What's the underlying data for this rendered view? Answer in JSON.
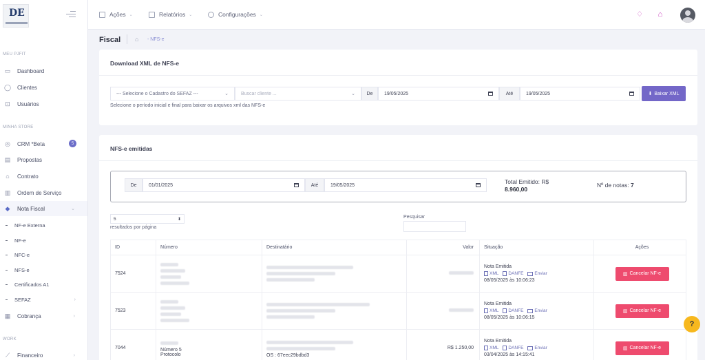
{
  "sidebar": {
    "sections": [
      {
        "title": "MEU PJFIT"
      },
      {
        "title": "MINHA STORE"
      },
      {
        "title": "WORK"
      }
    ],
    "items": [
      {
        "label": "Dashboard",
        "icon": "dashboard-icon"
      },
      {
        "label": "Clientes",
        "icon": "clients-icon"
      },
      {
        "label": "Usuários",
        "icon": "users-icon"
      },
      {
        "label": "CRM *Beta",
        "icon": "crm-icon",
        "badge": "5"
      },
      {
        "label": "Propostas",
        "icon": "proposals-icon"
      },
      {
        "label": "Contrato",
        "icon": "contract-icon"
      },
      {
        "label": "Ordem de Serviço",
        "icon": "service-order-icon"
      },
      {
        "label": "Nota Fiscal",
        "icon": "invoice-icon"
      },
      {
        "label": "Cobrança",
        "icon": "billing-icon"
      },
      {
        "label": "Financeiro",
        "icon": "finance-icon"
      }
    ],
    "subitems": [
      {
        "label": "NF-e Externa"
      },
      {
        "label": "NF-e"
      },
      {
        "label": "NFC-e"
      },
      {
        "label": "NFS-e"
      },
      {
        "label": "Certificados A1"
      },
      {
        "label": "SEFAZ"
      }
    ]
  },
  "topbar": {
    "menus": [
      {
        "label": "Ações"
      },
      {
        "label": "Relatórios"
      },
      {
        "label": "Configurações"
      }
    ]
  },
  "breadcrumb": {
    "title": "Fiscal",
    "current": "- NFS-e"
  },
  "download_card": {
    "title": "Download XML de NFS-e",
    "cadastro_placeholder": "--- Selecione o Cadastro do SEFAZ ---",
    "cliente_placeholder": "Buscar cliente ...",
    "de_label": "De",
    "de_value": "19/05/2025",
    "ate_label": "Até",
    "ate_value": "19/05/2025",
    "button_label": "Baixar XML",
    "hint": "Selecione o período inicial e final para baixar os arquivos xml das NFS-e"
  },
  "emitidas_card": {
    "title": "NFS-e emitidas",
    "de_label": "De",
    "de_value": "01/01/2025",
    "ate_label": "Até",
    "ate_value": "19/05/2025",
    "total_label": "Total Emitido: R$",
    "total_value": "8.960,00",
    "notas_label": "Nº de notas:",
    "notas_value": "7",
    "page_size": "5",
    "page_size_label": "resultados por página",
    "search_label": "Pesquisar",
    "columns": [
      "ID",
      "Número",
      "Destinatário",
      "Valor",
      "Situação",
      "Ações"
    ],
    "rows": [
      {
        "id": "7524",
        "status": "Nota Emitida",
        "date": "08/05/2025 às 10:06:23",
        "valor": ""
      },
      {
        "id": "7523",
        "status": "Nota Emitida",
        "date": "08/05/2025 às 10:06:15",
        "valor": ""
      },
      {
        "id": "7044",
        "numero": "Número 5",
        "protocolo": "Protocolo",
        "os": "OS : 67eec29bdbd3",
        "status": "Nota Emitida",
        "date": "03/04/2025 às 14:15:41",
        "valor": "R$ 1.250,00"
      }
    ],
    "doc_links": {
      "xml": "XML",
      "danfe": "DANFE",
      "enviar": "Enviar"
    },
    "cancel_label": "Cancelar NF-e"
  },
  "help": "?"
}
